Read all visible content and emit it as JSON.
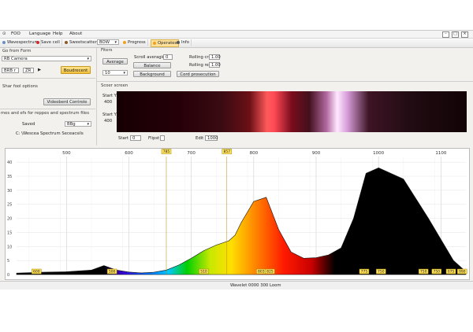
{
  "menu": {
    "items": [
      "FOO",
      "Language",
      "Help",
      "About"
    ]
  },
  "toolbar": {
    "items": [
      {
        "label": "Wavespectrum",
        "color": "#6b8ec7"
      },
      {
        "label": "Save cell",
        "color": "#c9302c"
      },
      {
        "label": "Sweetscatter",
        "color": "#8a5a2a"
      },
      {
        "label": "Progress",
        "color": "#f0a020"
      },
      {
        "label": "Operates",
        "color": "#f0a020",
        "active": true
      },
      {
        "label": "Info",
        "color": "#555555"
      }
    ],
    "select_value": "BOW"
  },
  "left": {
    "section1_title": "Go from Form",
    "camera_select": "RB Camera",
    "field_a": "BRB r",
    "field_b": "ZR",
    "play_btn": "▶",
    "buy_btn": "Boudrecent",
    "section2_title": "Shar fool options",
    "spectral_btn": "Videoberd Controle",
    "section3_title": "mes and efs for reppes and spectrum files",
    "saved_label": "Saved",
    "file_select": "BBg",
    "path_text": "C: \\Wescea Spectrum Seceacsils"
  },
  "filter": {
    "title": "Fiters",
    "average_btn": "Average",
    "frames_btn": "Balance",
    "frames_value": "10",
    "spin_label": "Scroll averaging",
    "spin_value": "0",
    "background_btn": "Background",
    "rolling1_label": "Rolling cross",
    "rolling1_value": "1.00",
    "rolling2_label": "Rolling rect",
    "rolling2_value": "1.00",
    "correction_btn": "Cord prosecution"
  },
  "screen": {
    "title": "Scoer screen",
    "start_y_label": "Start Y",
    "start_y_value": "400",
    "start_y2_label": "Start Y",
    "start_y2_value": "400",
    "start_label": "Start",
    "start_value": "0",
    "flip_label": "Flipst",
    "end_label": "Edit",
    "end_value": "1000"
  },
  "chart_data": {
    "type": "area",
    "xlabel": "Wavelet 0000 300 Loom",
    "x_ticks": [
      500,
      600,
      700,
      800,
      900,
      1000,
      1100
    ],
    "x_tick_labels": [
      "500",
      "600",
      "700",
      "800",
      "900",
      "1000",
      "1100"
    ],
    "xlim": [
      420,
      1140
    ],
    "y_ticks": [
      0,
      5,
      10,
      15,
      20,
      25,
      30,
      35,
      40
    ],
    "ylim": [
      0,
      42
    ],
    "grid": true,
    "x": [
      420,
      460,
      500,
      540,
      560,
      580,
      600,
      620,
      640,
      660,
      680,
      700,
      720,
      740,
      760,
      770,
      780,
      800,
      820,
      840,
      860,
      880,
      900,
      920,
      940,
      960,
      980,
      1000,
      1040,
      1080,
      1120,
      1140
    ],
    "y": [
      0.5,
      0.8,
      1.0,
      1.6,
      3.2,
      1.6,
      0.9,
      0.6,
      0.8,
      1.6,
      3.4,
      5.8,
      8.5,
      10.5,
      12.0,
      14.0,
      18.5,
      26.0,
      27.5,
      16.0,
      8.0,
      5.8,
      6.0,
      7.0,
      9.5,
      20.0,
      36.0,
      38.0,
      34.0,
      20.0,
      5.0,
      1.0
    ],
    "top_markers": [
      {
        "x": 660,
        "label": "785"
      },
      {
        "x": 757,
        "label": "857"
      }
    ],
    "bottom_markers": [
      {
        "x": 452,
        "label": "600"
      },
      {
        "x": 573,
        "label": "500"
      },
      {
        "x": 720,
        "label": "510"
      },
      {
        "x": 812,
        "label": "803"
      },
      {
        "x": 826,
        "label": "825"
      },
      {
        "x": 977,
        "label": "775"
      },
      {
        "x": 1004,
        "label": "750"
      },
      {
        "x": 1072,
        "label": "750"
      },
      {
        "x": 1093,
        "label": "750"
      },
      {
        "x": 1116,
        "label": "075"
      },
      {
        "x": 1134,
        "label": "990"
      }
    ]
  }
}
